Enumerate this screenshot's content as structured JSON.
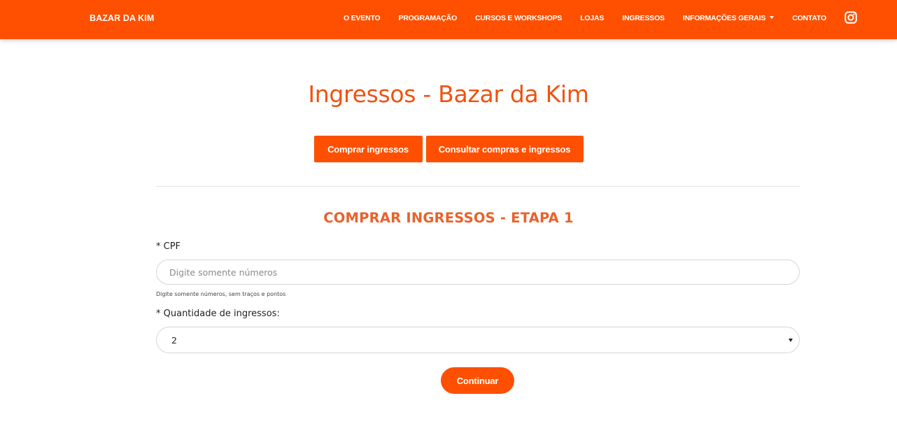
{
  "navbar": {
    "brand": "BAZAR DA KIM",
    "links": [
      "O EVENTO",
      "PROGRAMAÇÃO",
      "CURSOS E WORKSHOPS",
      "LOJAS",
      "INGRESSOS",
      "INFORMAÇÕES GERAIS",
      "CONTATO"
    ],
    "social_icon": "instagram-icon"
  },
  "main": {
    "title": "Ingressos - Bazar da Kim",
    "buttons": {
      "buy": "Comprar ingressos",
      "check": "Consultar compras e ingressos"
    },
    "step_title": "COMPRAR INGRESSOS - ETAPA 1",
    "form": {
      "cpf_label": "* CPF",
      "cpf_placeholder": "Digite somente números",
      "cpf_value": "",
      "cpf_help": "Digite somente números, sem traços e pontos",
      "qty_label": "* Quantidade de ingressos:",
      "qty_selected": "2",
      "continue_label": "Continuar"
    }
  },
  "colors": {
    "brand_orange": "#fe5000",
    "title_orange": "#ef5211",
    "background": "#ffffff"
  }
}
